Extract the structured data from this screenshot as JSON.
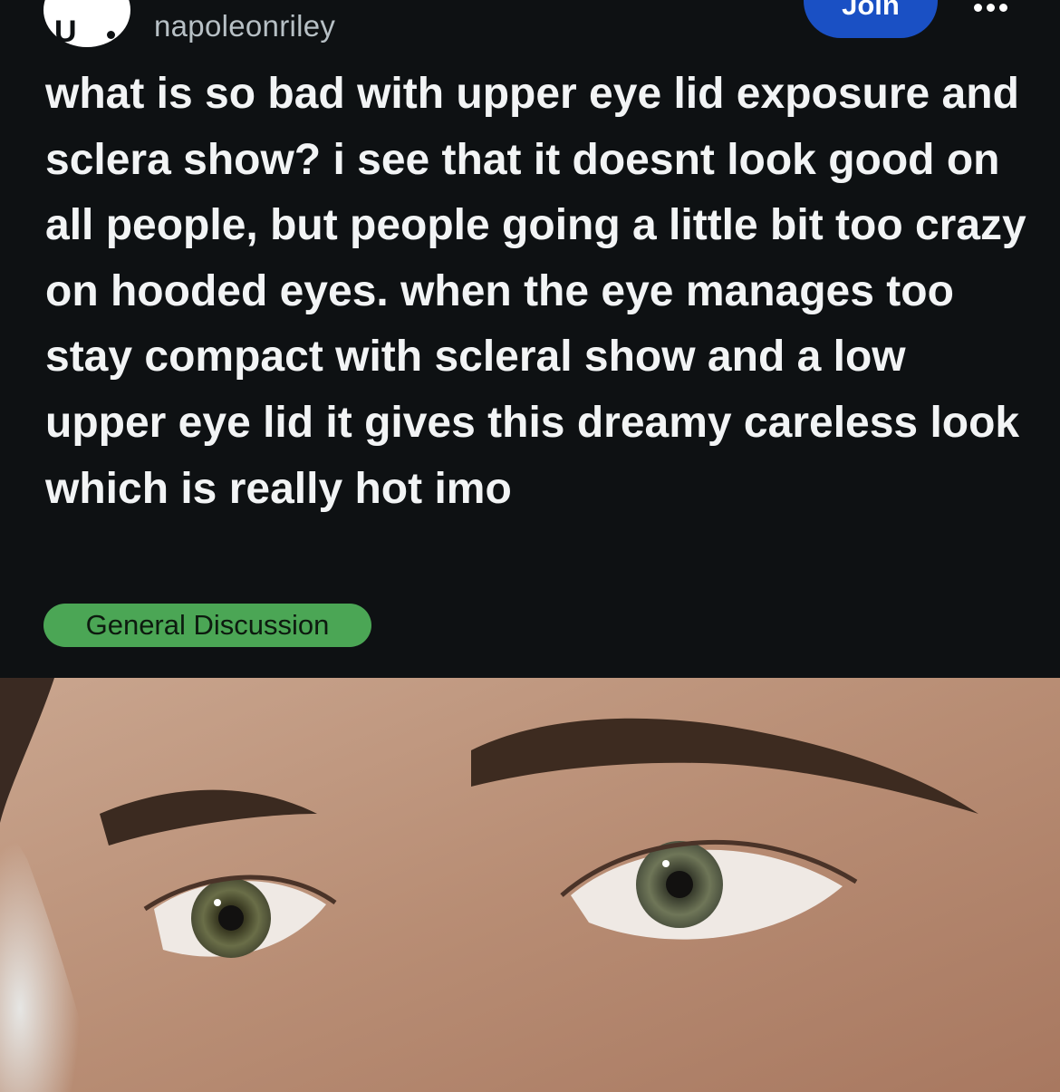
{
  "post": {
    "username": "napoleonriley",
    "join_label": "Join",
    "title": "what is so bad with upper eye lid exposure and sclera show? i see that it doesnt look good on all people, but people going a little bit too crazy on hooded eyes. when the eye manages too stay compact with scleral show and a low upper eye lid it gives this dreamy careless look which is really hot imo",
    "flair": "General Discussion"
  },
  "colors": {
    "background": "#0e1113",
    "join_button": "#1a50c4",
    "flair": "#4ba655"
  },
  "icons": [
    "community-avatar-icon",
    "more-options-icon"
  ]
}
